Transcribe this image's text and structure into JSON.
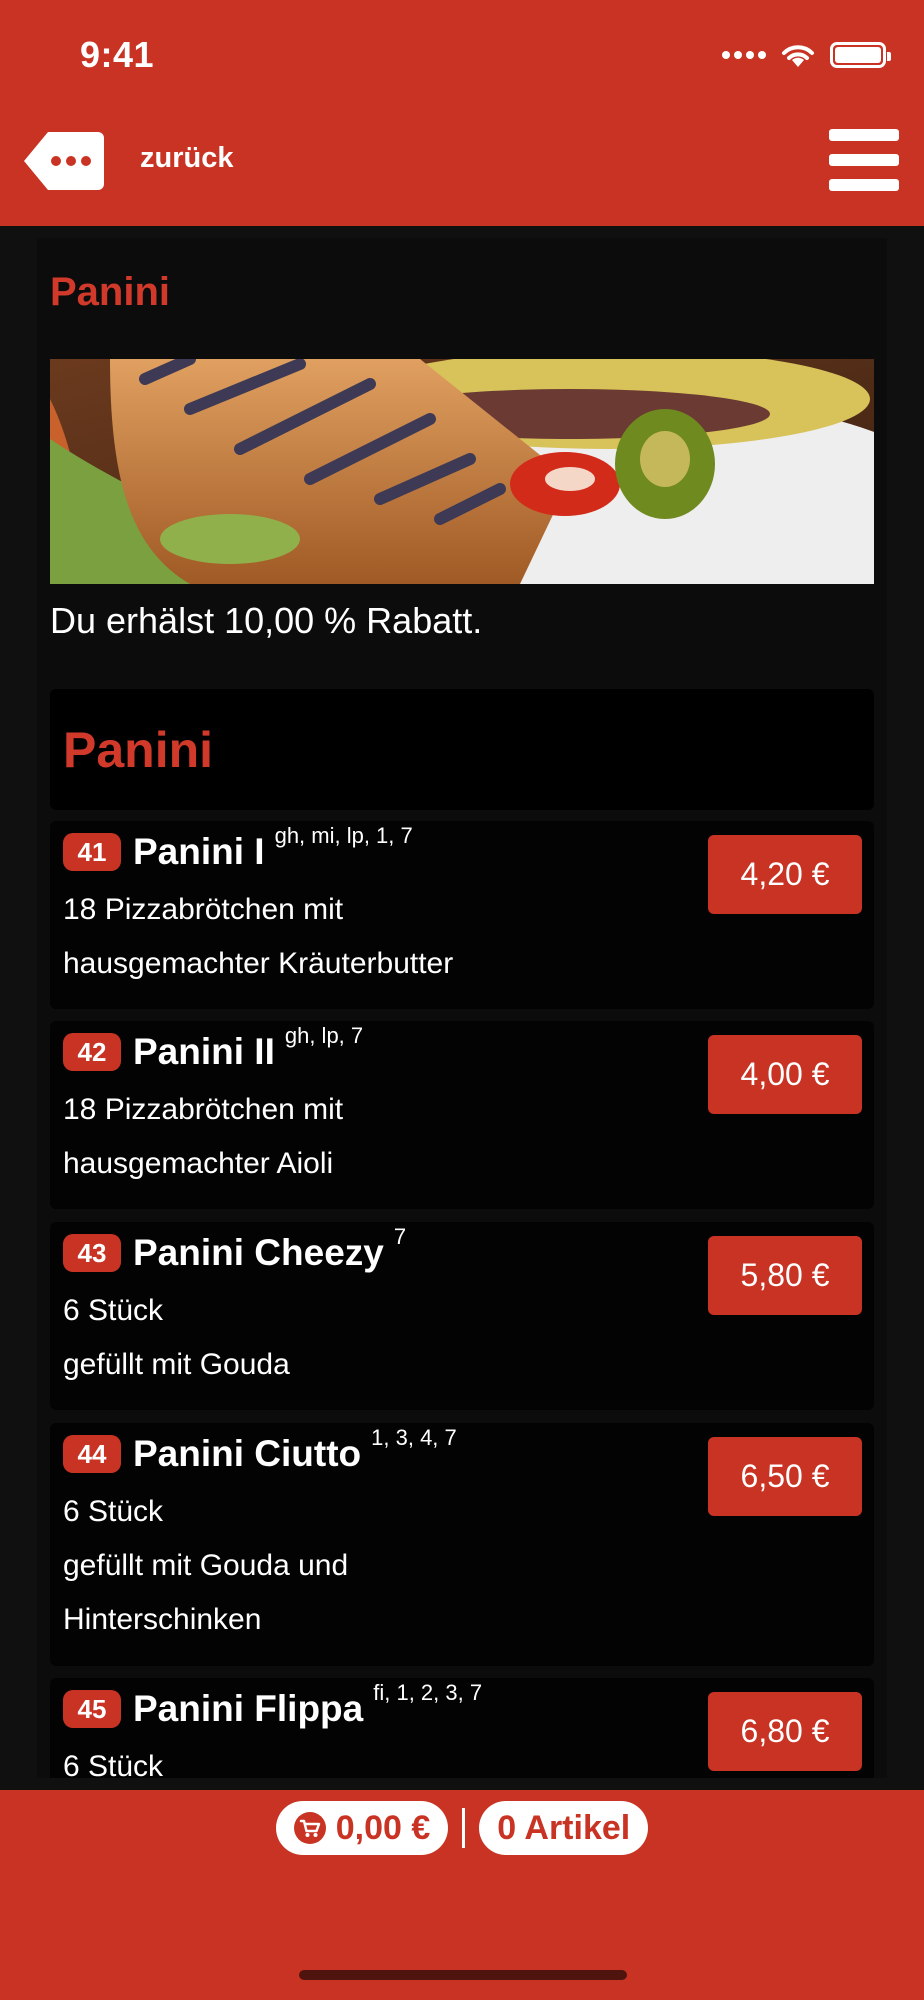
{
  "status_bar": {
    "time": "9:41"
  },
  "nav": {
    "back_label": "zurück",
    "menu_icon": "hamburger-menu-icon",
    "back_icon": "more-tag-icon"
  },
  "page": {
    "title": "Panini",
    "discount_text": "Du erhälst 10,00 % Rabatt.",
    "category_title": "Panini"
  },
  "items": [
    {
      "number": "41",
      "name": "Panini I",
      "allergens": "gh, mi, lp, 1, 7",
      "desc_line1": "18 Pizzabrötchen mit",
      "desc_line2": "hausgemachter Kräuterbutter",
      "desc_line3": "",
      "price": "4,20 €"
    },
    {
      "number": "42",
      "name": "Panini II",
      "allergens": "gh, lp, 7",
      "desc_line1": "18 Pizzabrötchen mit",
      "desc_line2": "hausgemachter Aioli",
      "desc_line3": "",
      "price": "4,00 €"
    },
    {
      "number": "43",
      "name": "Panini Cheezy",
      "allergens": "7",
      "desc_line1": "6 Stück",
      "desc_line2": "gefüllt mit Gouda",
      "desc_line3": "",
      "price": "5,80 €"
    },
    {
      "number": "44",
      "name": "Panini Ciutto",
      "allergens": "1, 3, 4, 7",
      "desc_line1": "6 Stück",
      "desc_line2": "gefüllt mit Gouda und",
      "desc_line3": "Hinterschinken",
      "price": "6,50 €"
    },
    {
      "number": "45",
      "name": "Panini Flippa",
      "allergens": "fi, 1, 2, 3, 7",
      "desc_line1": "6 Stück",
      "desc_line2": "",
      "desc_line3": "",
      "price": "6,80 €"
    }
  ],
  "cart": {
    "total": "0,00 €",
    "count": "0 Artikel",
    "icon": "cart-icon"
  },
  "colors": {
    "brand_red": "#c93323",
    "title_red": "#d13a2a",
    "background": "#101010"
  }
}
